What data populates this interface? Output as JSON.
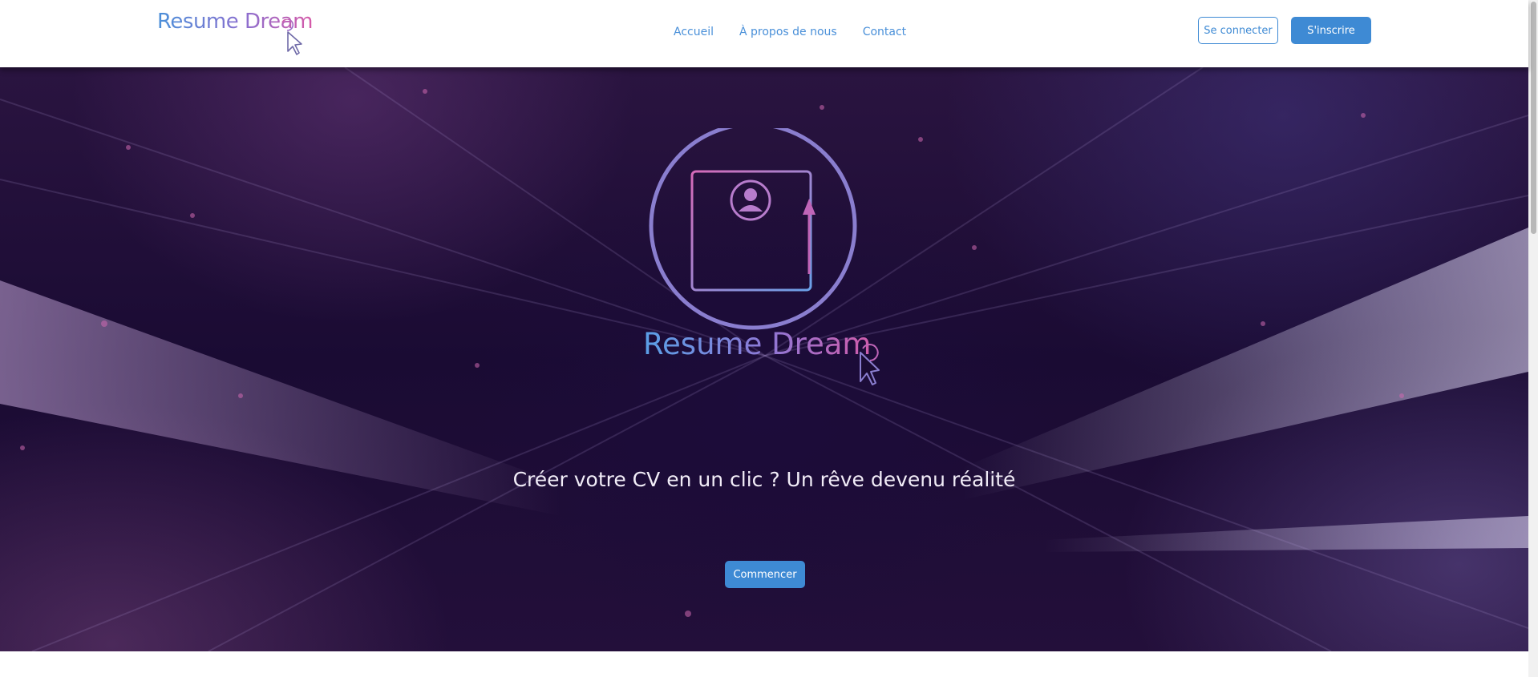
{
  "brand": {
    "name": "Resume Dream"
  },
  "nav": {
    "links": [
      {
        "label": "Accueil"
      },
      {
        "label": "À propos de nous"
      },
      {
        "label": "Contact"
      }
    ],
    "login_label": "Se connecter",
    "signup_label": "S'inscrire"
  },
  "hero": {
    "logo_text": "Resume Dream",
    "tagline": "Créer votre CV en un clic ? Un rêve devenu réalité",
    "cta_label": "Commencer"
  },
  "colors": {
    "accent_blue": "#3e8ad4",
    "brand_pink": "#d65aa8",
    "hero_background": "#1a0b33"
  },
  "icons": {
    "brand_cursor": "cursor-arrow-icon",
    "hero_resume": "resume-document-icon",
    "hero_avatar": "user-avatar-icon",
    "hero_arrow": "arrow-up-icon"
  }
}
